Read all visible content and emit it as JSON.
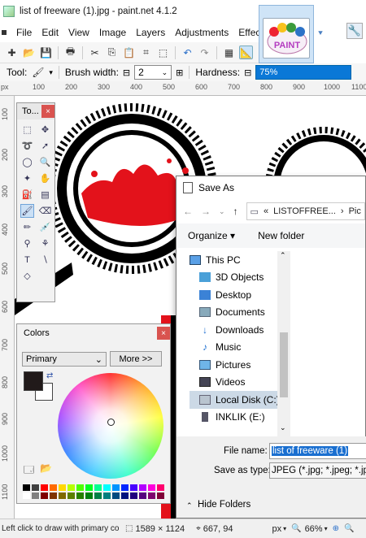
{
  "window": {
    "title": "list of freeware (1).jpg - paint.net 4.1.2"
  },
  "menu": [
    "File",
    "Edit",
    "View",
    "Image",
    "Layers",
    "Adjustments",
    "Effects"
  ],
  "toolbar2": {
    "tool_label": "Tool:",
    "brush_width_label": "Brush width:",
    "brush_width_value": "2",
    "hardness_label": "Hardness:",
    "hardness_value": "75%"
  },
  "logo": {
    "text": "PAINT"
  },
  "ruler": {
    "unit": "px",
    "top": [
      "100",
      "200",
      "300",
      "400",
      "500",
      "600",
      "700",
      "800",
      "900",
      "1000",
      "1100"
    ],
    "left": [
      "100",
      "200",
      "300",
      "400",
      "500",
      "600",
      "700",
      "800",
      "900",
      "1000",
      "1100"
    ]
  },
  "tools_window": {
    "title": "To...",
    "close": "×"
  },
  "colors_window": {
    "title": "Colors",
    "close": "×",
    "mode": "Primary",
    "more": "More >>",
    "primary_color": "#211a1a",
    "secondary_color": "#ffffff"
  },
  "save_dialog": {
    "title": "Save As",
    "address": {
      "prefix": "«",
      "folder": "LISTOFFREE...",
      "next": "Pic"
    },
    "organize": "Organize ▾",
    "new_folder": "New folder",
    "tree": [
      "This PC",
      "3D Objects",
      "Desktop",
      "Documents",
      "Downloads",
      "Music",
      "Pictures",
      "Videos",
      "Local Disk (C:)",
      "INKLIK (E:)"
    ],
    "file_name_label": "File name:",
    "file_name_value": "list of freeware (1)",
    "save_type_label": "Save as type:",
    "save_type_value": "JPEG (*.jpg; *.jpeg; *.jpe; *",
    "hide_folders": "Hide Folders"
  },
  "status": {
    "hint": "Left click to draw with primary color, right clic...",
    "size": "1589 × 1124",
    "coords": "667, 94",
    "unit": "px",
    "zoom": "66%"
  }
}
